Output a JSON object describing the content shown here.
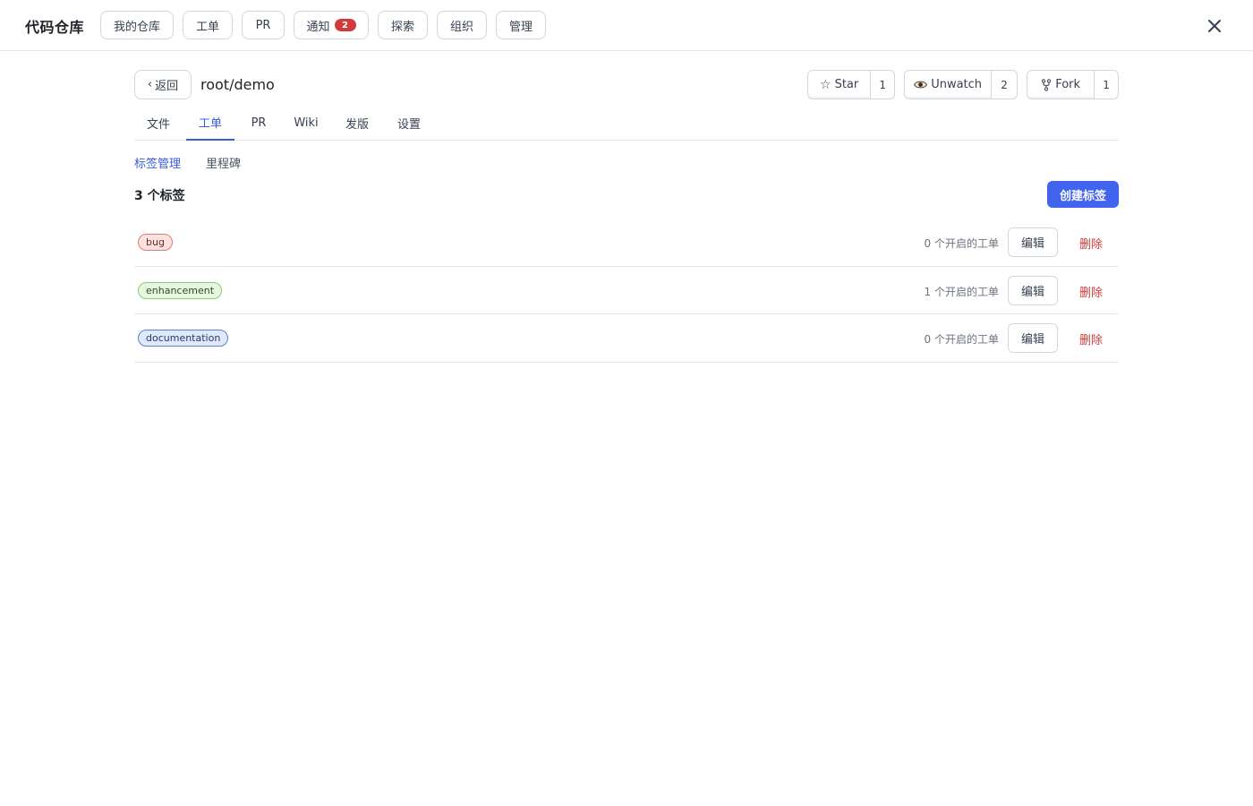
{
  "topbar": {
    "title": "代码仓库",
    "nav": [
      {
        "label": "我的仓库"
      },
      {
        "label": "工单"
      },
      {
        "label": "PR"
      },
      {
        "label": "通知",
        "badge": "2"
      },
      {
        "label": "探索"
      },
      {
        "label": "组织"
      },
      {
        "label": "管理"
      }
    ],
    "close_icon": "close-icon"
  },
  "repo": {
    "back_label": "返回",
    "name": "root/demo",
    "star": {
      "label": "Star",
      "count": "1",
      "icon": "star-icon"
    },
    "watch": {
      "label": "Unwatch",
      "count": "2",
      "icon": "eye-icon"
    },
    "fork": {
      "label": "Fork",
      "count": "1",
      "icon": "fork-icon"
    }
  },
  "tabs": [
    {
      "label": "文件"
    },
    {
      "label": "工单",
      "active": true
    },
    {
      "label": "PR"
    },
    {
      "label": "Wiki"
    },
    {
      "label": "发版"
    },
    {
      "label": "设置"
    }
  ],
  "subnav": [
    {
      "label": "标签管理",
      "active": true
    },
    {
      "label": "里程碑"
    }
  ],
  "labels_section": {
    "count_title": "3 个标签",
    "create_label": "创建标签",
    "edit_label": "编辑",
    "delete_label": "删除",
    "items": [
      {
        "name": "bug",
        "open_issues": "0 个开启的工单",
        "bg": "#fde2e1",
        "border": "#e07a74",
        "text": "#6b2b28"
      },
      {
        "name": "enhancement",
        "open_issues": "1 个开启的工单",
        "bg": "#e6f6df",
        "border": "#8bc97a",
        "text": "#2f4f29"
      },
      {
        "name": "documentation",
        "open_issues": "0 个开启的工单",
        "bg": "#dfe9fb",
        "border": "#5b7fd6",
        "text": "#263b6b"
      }
    ]
  },
  "colors": {
    "accent": "#3b5bdb",
    "primary_button": "#4263eb",
    "danger": "#d23b3b",
    "badge": "#d23b3b"
  }
}
